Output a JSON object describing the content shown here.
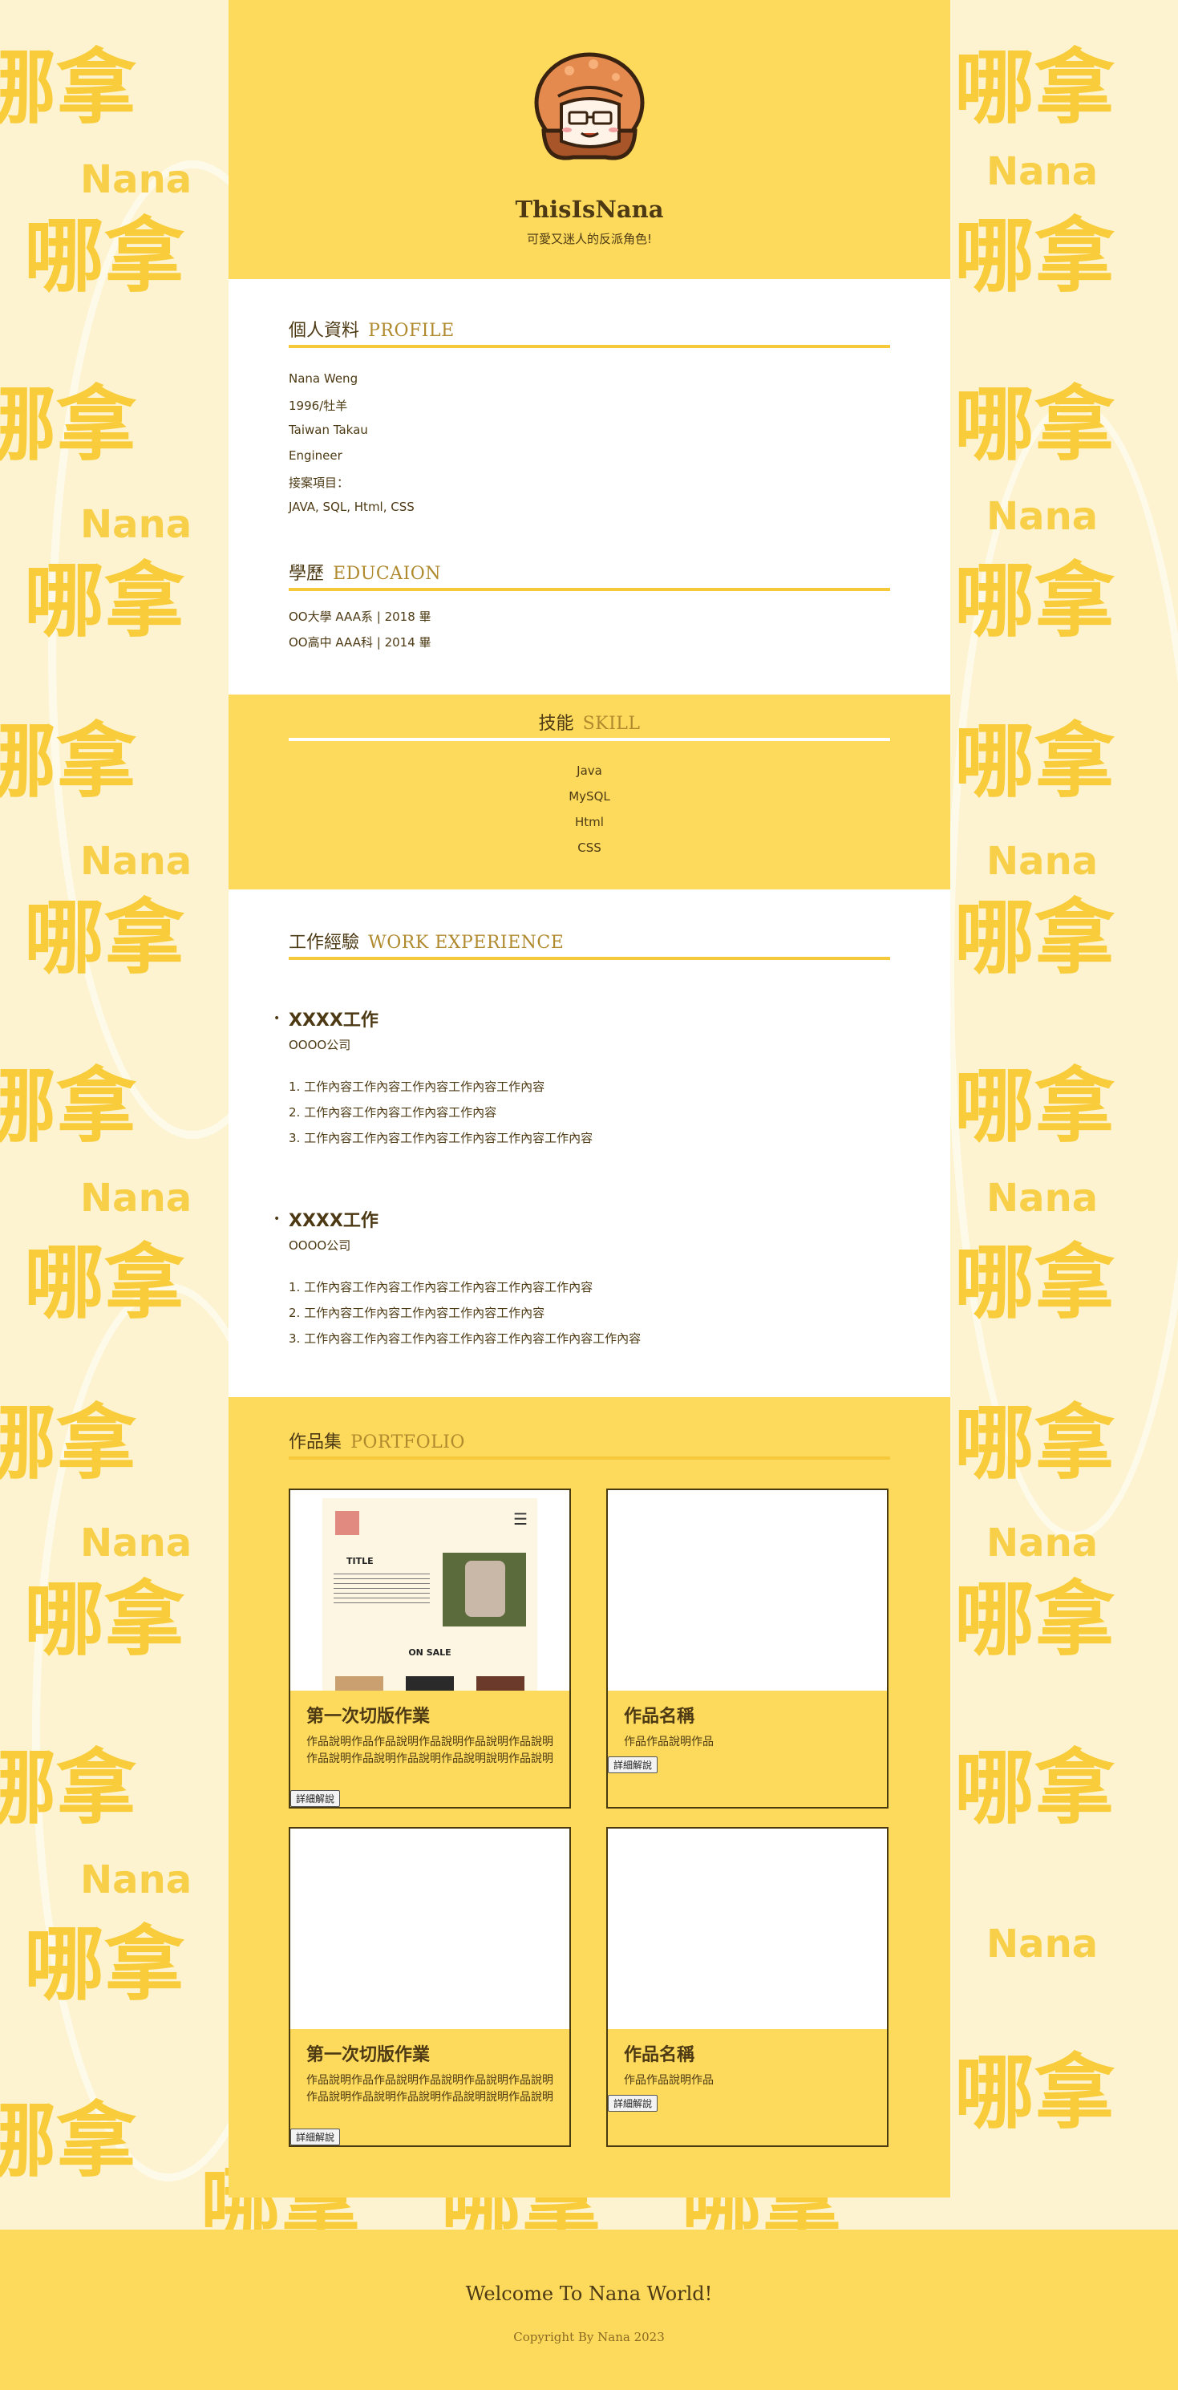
{
  "header": {
    "title": "ThisIsNana",
    "subtitle": "可愛又迷人的反派角色!"
  },
  "background_text": {
    "big": "哪拿",
    "small": "Nana"
  },
  "profile": {
    "title_zh": "個人資料",
    "title_en": "PROFILE",
    "lines": [
      "Nana Weng",
      "1996/牡羊",
      "Taiwan Takau",
      "Engineer",
      "接案項目：",
      "JAVA, SQL, Html, CSS"
    ]
  },
  "education": {
    "title_zh": "學歷",
    "title_en": "EDUCAION",
    "lines": [
      "OO大學 AAA系 | 2018 畢",
      "OO高中 AAA科 | 2014 畢"
    ]
  },
  "skill": {
    "title_zh": "技能",
    "title_en": "SKILL",
    "items": [
      "Java",
      "MySQL",
      "Html",
      "CSS"
    ]
  },
  "work": {
    "title_zh": "工作經驗",
    "title_en": "WORK EXPERIENCE",
    "jobs": [
      {
        "title": "XXXX工作",
        "company": "OOOO公司",
        "items": [
          "1. 工作內容工作內容工作內容工作內容工作內容",
          "2. 工作內容工作內容工作內容工作內容",
          "3. 工作內容工作內容工作內容工作內容工作內容工作內容"
        ]
      },
      {
        "title": "XXXX工作",
        "company": "OOOO公司",
        "items": [
          "1. 工作內容工作內容工作內容工作內容工作內容工作內容",
          "2. 工作內容工作內容工作內容工作內容工作內容",
          "3. 工作內容工作內容工作內容工作內容工作內容工作內容工作內容"
        ]
      }
    ]
  },
  "portfolio": {
    "title_zh": "作品集",
    "title_en": "PORTFOLIO",
    "thumb_mock": {
      "title": "TITLE",
      "sale": "ON SALE",
      "menu_icon": "hamburger-icon"
    },
    "cards": [
      {
        "title": "第一次切版作業",
        "desc": "作品說明作品作品說明作品說明作品說明作品說明作品說明作品說明作品說明作品說明說明作品說明",
        "button": "詳細解說"
      },
      {
        "title": "作品名稱",
        "desc": "作品作品說明作品",
        "button": "詳細解說"
      },
      {
        "title": "第一次切版作業",
        "desc": "作品說明作品作品說明作品說明作品說明作品說明作品說明作品說明作品說明作品說明說明作品說明",
        "button": "詳細解說"
      },
      {
        "title": "作品名稱",
        "desc": "作品作品說明作品",
        "button": "詳細解說"
      }
    ]
  },
  "footer": {
    "welcome": "Welcome To Nana World!",
    "copyright": "Copyright By Nana 2023"
  },
  "colors": {
    "accent": "#fdda5b",
    "line": "#f5c93a",
    "text": "#4d3a14",
    "background": "#fdf3d0"
  }
}
